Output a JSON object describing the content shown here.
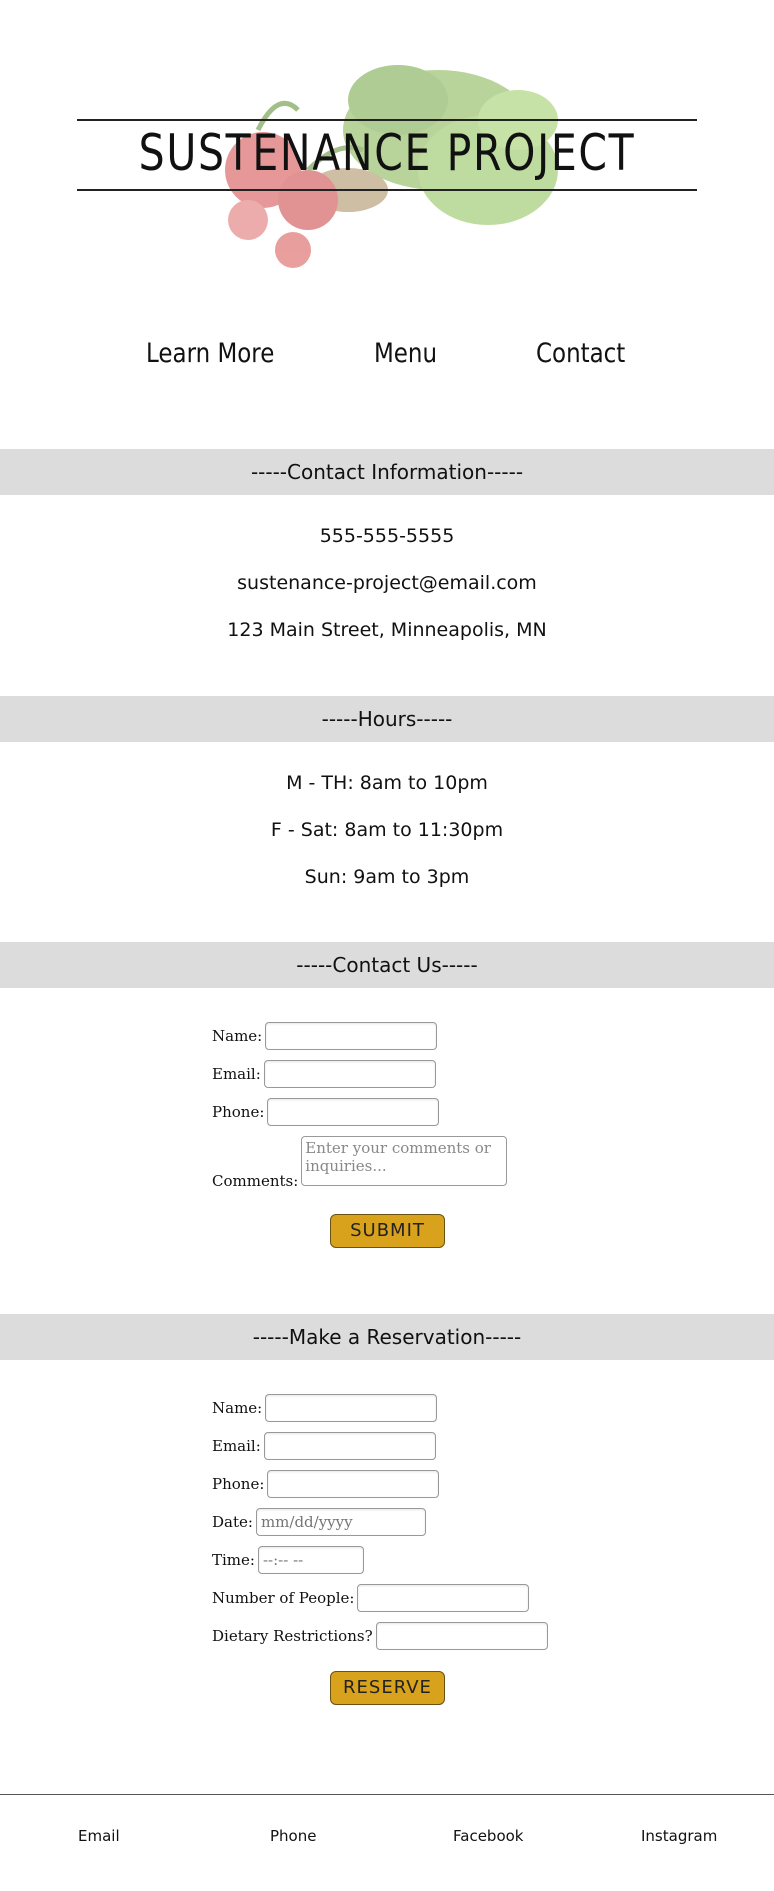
{
  "header": {
    "title": "SUSTENANCE PROJECT",
    "hero_icon": "radish-lettuce-illustration"
  },
  "nav": {
    "learn_more": "Learn More",
    "menu": "Menu",
    "contact": "Contact"
  },
  "contact_info": {
    "heading": "-----Contact Information-----",
    "phone": "555-555-5555",
    "email": "sustenance-project@email.com",
    "address": "123 Main Street, Minneapolis, MN"
  },
  "hours": {
    "heading": "-----Hours-----",
    "weekday": "M - TH: 8am to 10pm",
    "weekend": "F - Sat: 8am to 11:30pm",
    "sunday": "Sun: 9am to 3pm"
  },
  "contact_form": {
    "heading": "-----Contact Us-----",
    "name_label": "Name:",
    "email_label": "Email:",
    "phone_label": "Phone:",
    "comments_label": "Comments:",
    "comments_placeholder": "Enter your comments or inquiries...",
    "submit_label": "SUBMIT"
  },
  "reservation_form": {
    "heading": "-----Make a Reservation-----",
    "name_label": "Name:",
    "email_label": "Email:",
    "phone_label": "Phone:",
    "date_label": "Date:",
    "date_placeholder": "mm/dd/yyyy",
    "time_label": "Time:",
    "time_placeholder": "--:-- --",
    "people_label": "Number of People:",
    "dietary_label": "Dietary Restrictions?",
    "reserve_label": "RESERVE"
  },
  "footer": {
    "email": "Email",
    "phone": "Phone",
    "facebook": "Facebook",
    "instagram": "Instagram"
  },
  "colors": {
    "band": "#dcdcdc",
    "button": "#d9a21c"
  }
}
